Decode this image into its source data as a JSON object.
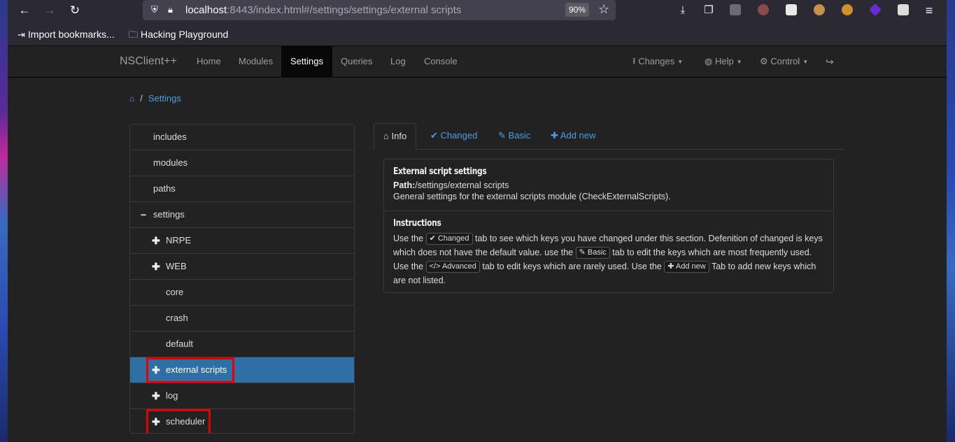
{
  "browser": {
    "url_host": "localhost",
    "url_rest": ":8443/index.html#/settings/settings/external scripts",
    "zoom": "90%",
    "bookmarks": [
      "Import bookmarks...",
      "Hacking Playground"
    ]
  },
  "navbar": {
    "brand": "NSClient++",
    "items": [
      "Home",
      "Modules",
      "Settings",
      "Queries",
      "Log",
      "Console"
    ],
    "active": "Settings",
    "right": [
      "Changes",
      "Help",
      "Control"
    ]
  },
  "breadcrumb": {
    "current": "Settings"
  },
  "tree": {
    "items": [
      {
        "label": "includes",
        "toggle": ""
      },
      {
        "label": "modules",
        "toggle": ""
      },
      {
        "label": "paths",
        "toggle": ""
      },
      {
        "label": "settings",
        "toggle": "−"
      },
      {
        "label": "NRPE",
        "toggle": "✚"
      },
      {
        "label": "WEB",
        "toggle": "✚"
      },
      {
        "label": "core",
        "toggle": ""
      },
      {
        "label": "crash",
        "toggle": ""
      },
      {
        "label": "default",
        "toggle": ""
      },
      {
        "label": "external scripts",
        "toggle": "✚"
      },
      {
        "label": "log",
        "toggle": "✚"
      },
      {
        "label": "scheduler",
        "toggle": "✚"
      }
    ]
  },
  "tabs": [
    "Info",
    "Changed",
    "Basic",
    "Add new"
  ],
  "panel": {
    "title": "External script settings",
    "path_label": "Path:",
    "path": "/settings/external scripts",
    "description": "General settings for the external scripts module (CheckExternalScripts).",
    "instructions_title": "Instructions",
    "instr_1": "Use the",
    "kbd_changed": "Changed",
    "instr_2": "tab to see which keys you have changed under this section. Defenition of changed is keys which does not have the default value. use the",
    "kbd_basic": "Basic",
    "instr_3": "tab to edit the keys which are most frequently used. Use the",
    "kbd_advanced": "Advanced",
    "instr_4": "tab to edit keys which are rarely used. Use the",
    "kbd_addnew": "Add new",
    "instr_5": "Tab to add new keys which are not listed."
  },
  "colors": {
    "accent": "#4a9fde",
    "active_row": "#2f6fa5",
    "highlight_box": "#e30000"
  }
}
